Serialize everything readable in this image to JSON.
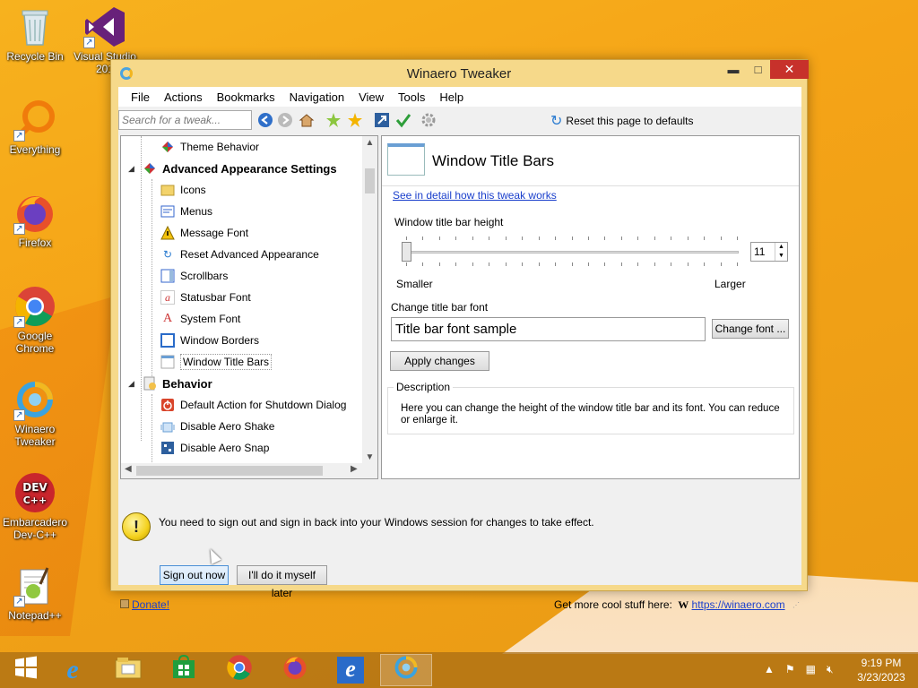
{
  "desktop": {
    "icons": [
      {
        "label": "Recycle Bin"
      },
      {
        "label": "Visual Studio 201"
      },
      {
        "label": "Everything"
      },
      {
        "label": "Firefox"
      },
      {
        "label": "Google Chrome"
      },
      {
        "label": "Winaero Tweaker"
      },
      {
        "label": "Embarcadero Dev-C++"
      },
      {
        "label": "Notepad++"
      }
    ]
  },
  "window": {
    "title": "Winaero Tweaker",
    "controls": {
      "minimize": "▬",
      "maximize": "□",
      "close": "✕"
    }
  },
  "menu": [
    "File",
    "Actions",
    "Bookmarks",
    "Navigation",
    "View",
    "Tools",
    "Help"
  ],
  "toolbar": {
    "search_placeholder": "Search for a tweak...",
    "reset_label": "Reset this page to defaults"
  },
  "tree": {
    "items": [
      {
        "label": "Theme Behavior",
        "icon": "theme-icon",
        "kind": "child"
      },
      {
        "label": "Advanced Appearance Settings",
        "icon": "palette-icon",
        "kind": "category"
      },
      {
        "label": "Icons",
        "icon": "folder-icon",
        "kind": "child"
      },
      {
        "label": "Menus",
        "icon": "menu-icon",
        "kind": "child"
      },
      {
        "label": "Message Font",
        "icon": "warning-icon",
        "kind": "child"
      },
      {
        "label": "Reset Advanced Appearance",
        "icon": "refresh-icon",
        "kind": "child"
      },
      {
        "label": "Scrollbars",
        "icon": "scrollbar-icon",
        "kind": "child"
      },
      {
        "label": "Statusbar Font",
        "icon": "font-icon",
        "kind": "child"
      },
      {
        "label": "System Font",
        "icon": "font-icon",
        "kind": "child"
      },
      {
        "label": "Window Borders",
        "icon": "window-icon",
        "kind": "child"
      },
      {
        "label": "Window Title Bars",
        "icon": "window-icon",
        "kind": "selected"
      },
      {
        "label": "Behavior",
        "icon": "behavior-icon",
        "kind": "category"
      },
      {
        "label": "Default Action for Shutdown Dialog",
        "icon": "power-icon",
        "kind": "child"
      },
      {
        "label": "Disable Aero Shake",
        "icon": "shake-icon",
        "kind": "child"
      },
      {
        "label": "Disable Aero Snap",
        "icon": "snap-icon",
        "kind": "child"
      }
    ]
  },
  "panel": {
    "title": "Window Title Bars",
    "detail_link": "See in detail how this tweak works",
    "height_label": "Window title bar height",
    "height_value": "11",
    "slider_fraction": 0.0,
    "smaller_label": "Smaller",
    "larger_label": "Larger",
    "font_label": "Change title bar font",
    "font_sample": "Title bar font sample",
    "change_font_button": "Change font ...",
    "apply_button": "Apply changes",
    "description_legend": "Description",
    "description_text": "Here you can change the height of the window title bar and its font. You can reduce or enlarge it."
  },
  "notice": {
    "icon": "!",
    "text": "You need to sign out and sign in back into your Windows session for changes to take effect.",
    "signout_button": "Sign out now",
    "later_button": "I'll do it myself later"
  },
  "statusbar": {
    "donate": "Donate!",
    "more_text": "Get more cool stuff here:",
    "w_logo": "W",
    "url": "https://winaero.com"
  },
  "taskbar": {
    "time": "9:19 PM",
    "date": "3/23/2023"
  }
}
